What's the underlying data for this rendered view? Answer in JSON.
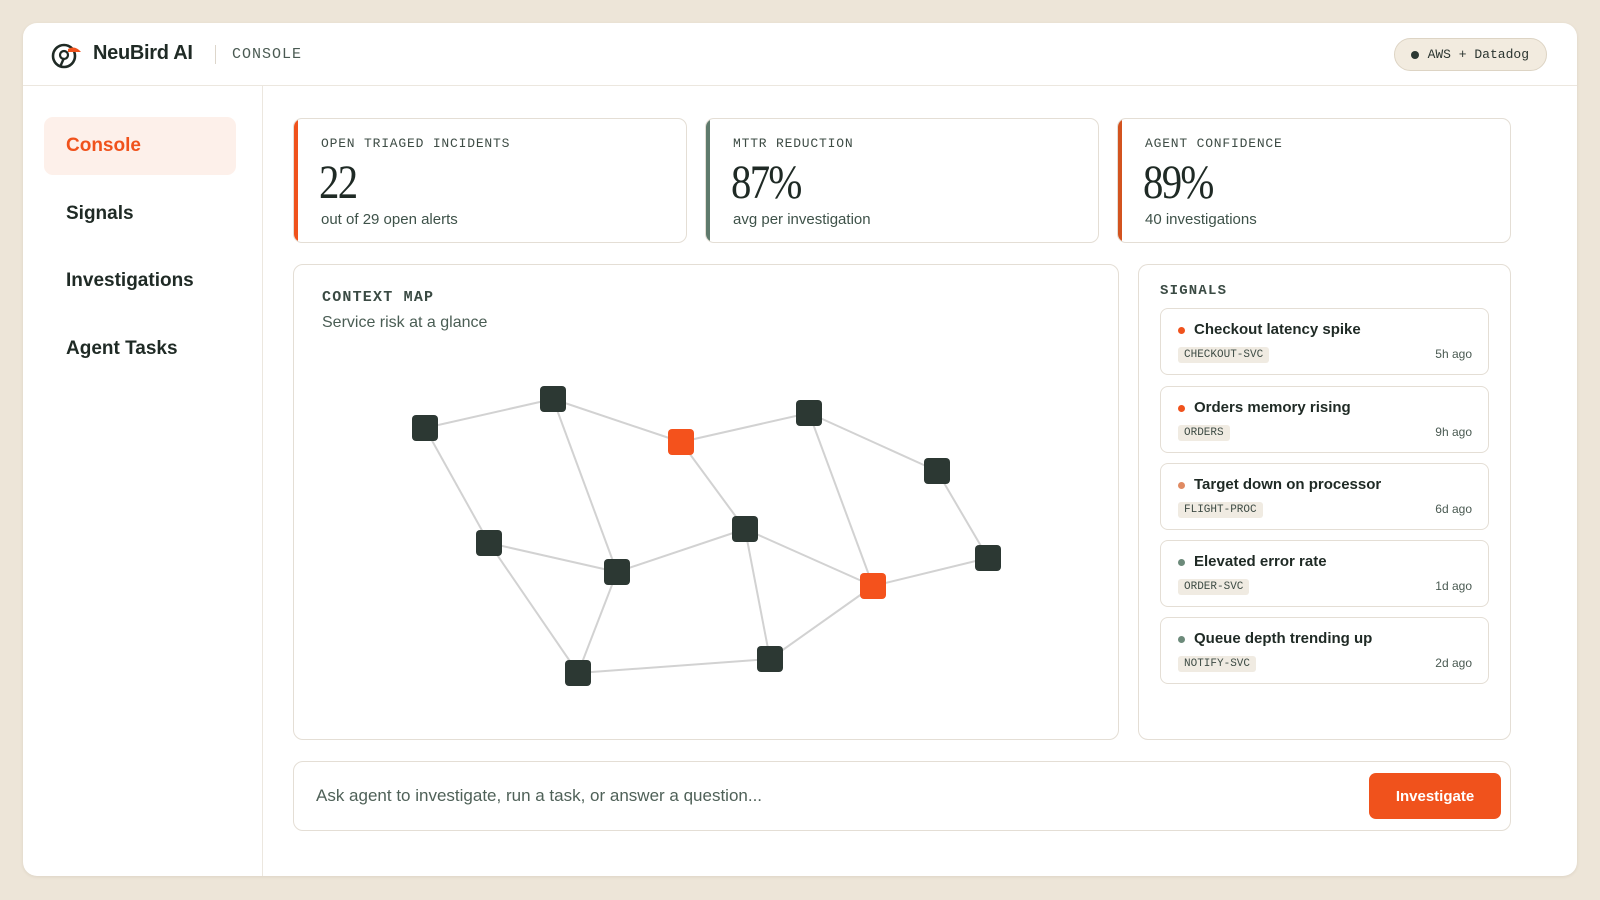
{
  "header": {
    "brand": "NeuBird AI",
    "section": "CONSOLE",
    "integration": "AWS + Datadog"
  },
  "sidebar": {
    "items": [
      {
        "label": "Console",
        "active": true
      },
      {
        "label": "Signals",
        "active": false
      },
      {
        "label": "Investigations",
        "active": false
      },
      {
        "label": "Agent Tasks",
        "active": false
      }
    ]
  },
  "stats": [
    {
      "label": "OPEN TRIAGED INCIDENTS",
      "value": "22",
      "sub": "out of 29 open alerts",
      "accent": "#f0521c"
    },
    {
      "label": "MTTR REDUCTION",
      "value": "87%",
      "sub": "avg per investigation",
      "accent": "#5f7a6c"
    },
    {
      "label": "AGENT CONFIDENCE",
      "value": "89%",
      "sub": "40 investigations",
      "accent": "#d3531f"
    }
  ],
  "context_map": {
    "title": "CONTEXT MAP",
    "subtitle": "Service risk at a glance"
  },
  "signals": {
    "title": "SIGNALS",
    "items": [
      {
        "title": "Checkout latency spike",
        "tag": "CHECKOUT-SVC",
        "time": "5h ago",
        "color": "#f0521c"
      },
      {
        "title": "Orders memory rising",
        "tag": "ORDERS",
        "time": "9h ago",
        "color": "#f0521c"
      },
      {
        "title": "Target down on processor",
        "tag": "FLIGHT-PROC",
        "time": "6d ago",
        "color": "#e08a62"
      },
      {
        "title": "Elevated error rate",
        "tag": "ORDER-SVC",
        "time": "1d ago",
        "color": "#6c8a7a"
      },
      {
        "title": "Queue depth trending up",
        "tag": "NOTIFY-SVC",
        "time": "2d ago",
        "color": "#6c8a7a"
      }
    ]
  },
  "query": {
    "placeholder": "Ask agent to investigate, run a task, or answer a question...",
    "button": "Investigate"
  },
  "colors": {
    "accent": "#f0521c",
    "node_dark": "#2c3833",
    "edge": "#d2d2d2"
  }
}
